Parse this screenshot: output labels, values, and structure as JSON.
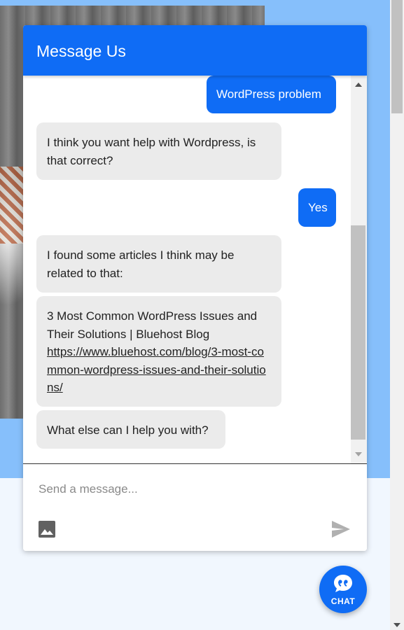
{
  "widget": {
    "title": "Message Us"
  },
  "messages": [
    {
      "from": "user",
      "text": "WordPress problem"
    },
    {
      "from": "bot",
      "text": "I think you want help with Wordpress, is that correct?"
    },
    {
      "from": "user",
      "text": "Yes"
    },
    {
      "from": "bot",
      "text": "I found some articles I think may be related to that:"
    },
    {
      "from": "bot",
      "title": "3 Most Common WordPress Issues and Their Solutions | Bluehost Blog",
      "link": "https://www.bluehost.com/blog/3-most-common-wordpress-issues-and-their-solutions/"
    },
    {
      "from": "bot",
      "text": "What else can I help you with?"
    }
  ],
  "composer": {
    "placeholder": "Send a message...",
    "image_icon": "image-icon",
    "send_icon": "send-icon"
  },
  "launcher": {
    "label": "CHAT",
    "icon": "chat-quote-icon"
  },
  "colors": {
    "accent": "#0f6cf5",
    "bot_bubble": "#ebebeb",
    "page_blue": "#86bffb"
  }
}
